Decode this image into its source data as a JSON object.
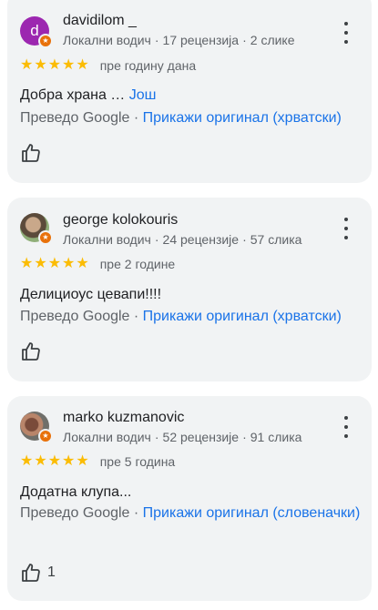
{
  "reviews": [
    {
      "author": "davidilom _",
      "avatar_letter": "d",
      "local_guide": "Локални водич",
      "reviews_count": "17 рецензија",
      "photos_count": "2 слике",
      "rating": 5,
      "time_ago": "пре годину дана",
      "text": "Добра храна …",
      "more": "Још",
      "translated_by": "Преведо Google",
      "show_original": "Прикажи оригинал (хрватски)",
      "likes": ""
    },
    {
      "author": "george kolokouris",
      "local_guide": "Локални водич",
      "reviews_count": "24 рецензије",
      "photos_count": "57 слика",
      "rating": 5,
      "time_ago": "пре 2 године",
      "text": "Делициоус цевапи!!!!",
      "translated_by": "Преведо Google",
      "show_original": "Прикажи оригинал (хрватски)",
      "likes": ""
    },
    {
      "author": "marko kuzmanovic",
      "local_guide": "Локални водич",
      "reviews_count": "52 рецензије",
      "photos_count": "91 слика",
      "rating": 5,
      "time_ago": "пре 5 година",
      "text": "Додатна клупа...",
      "translated_by": "Преведо Google",
      "show_original": "Прикажи оригинал (словеначки)",
      "likes": "1"
    }
  ],
  "icons": {
    "star": "star-icon",
    "like": "thumb-up-icon",
    "menu": "more-vert-icon",
    "badge": "local-guide-badge-icon"
  },
  "colors": {
    "card_bg": "#f1f3f4",
    "link": "#1a73e8",
    "star": "#fbbc04",
    "avatar_d": "#9c27b0",
    "badge": "#e8710a"
  }
}
